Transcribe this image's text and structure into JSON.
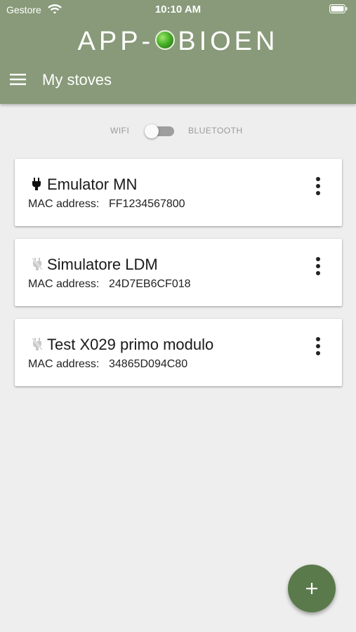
{
  "status_bar": {
    "carrier": "Gestore",
    "time": "10:10 AM"
  },
  "header": {
    "logo_left": "APP-",
    "logo_right": "BIOEN",
    "title": "My stoves"
  },
  "connection": {
    "left_label": "WIFI",
    "right_label": "BLUETOOTH",
    "bluetooth_selected": false
  },
  "devices": [
    {
      "name": "Emulator MN",
      "mac_label": "MAC address:",
      "mac": "FF1234567800",
      "connected": true
    },
    {
      "name": "Simulatore LDM",
      "mac_label": "MAC address:",
      "mac": "24D7EB6CF018",
      "connected": false
    },
    {
      "name": "Test X029 primo modulo",
      "mac_label": "MAC address:",
      "mac": "34865D094C80",
      "connected": false
    }
  ],
  "colors": {
    "header": "#889a79",
    "fab": "#5b7a4c",
    "background": "#eeeeee"
  },
  "icons": {
    "menu": "hamburger-menu-icon",
    "plug_connected": "plug-icon",
    "plug_disconnected": "plug-off-icon",
    "more": "more-vertical-icon",
    "add": "plus-icon"
  }
}
